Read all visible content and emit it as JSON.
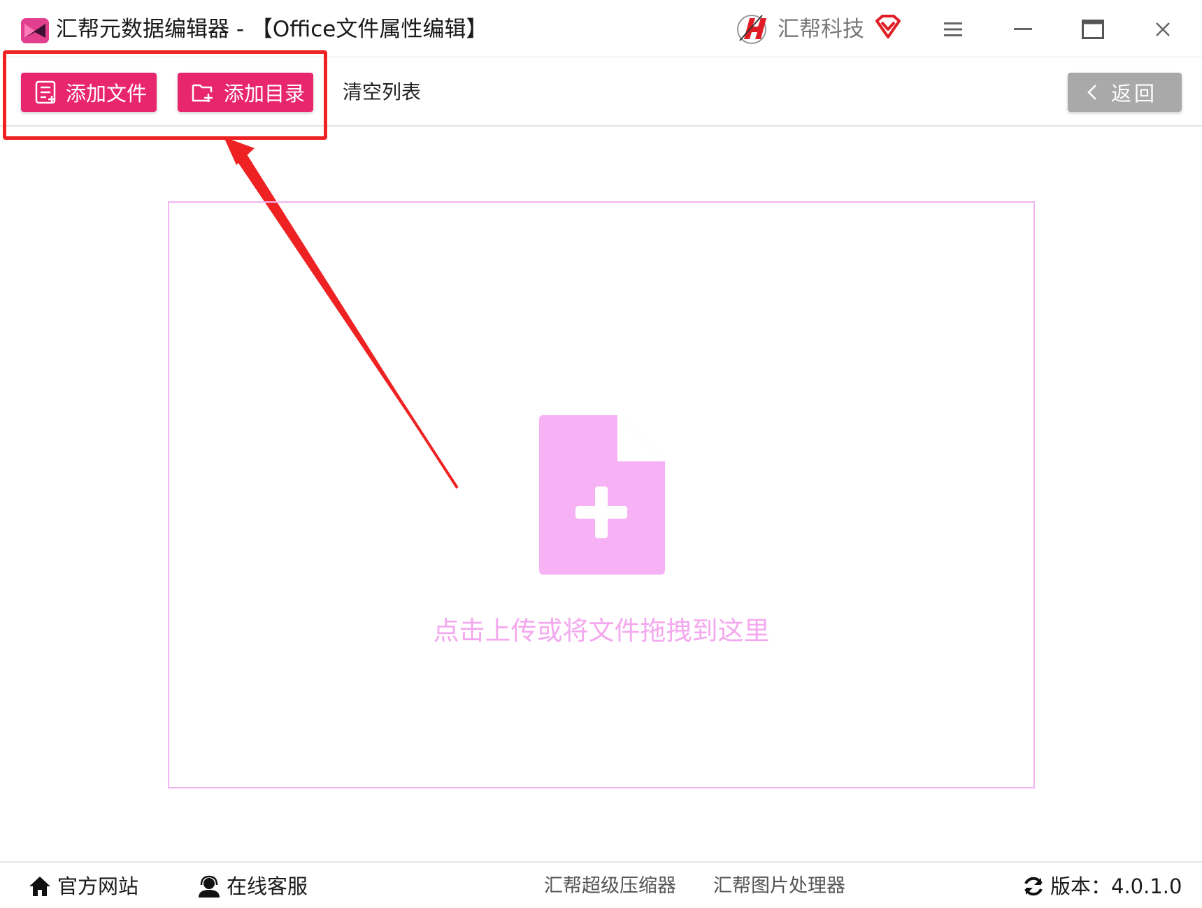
{
  "titlebar": {
    "title": "汇帮元数据编辑器 - 【Office文件属性编辑】",
    "brand": "汇帮科技"
  },
  "toolbar": {
    "add_file_label": "添加文件",
    "add_dir_label": "添加目录",
    "clear_label": "清空列表",
    "back_label": "返回"
  },
  "dropzone": {
    "hint": "点击上传或将文件拖拽到这里"
  },
  "footer": {
    "website": "官方网站",
    "service": "在线客服",
    "compressor": "汇帮超级压缩器",
    "image_tool": "汇帮图片处理器",
    "version": "版本：4.0.1.0"
  },
  "colors": {
    "accent": "#e8266e",
    "dropzone_border": "#f2b4f2",
    "dropzone_icon": "#f7b2f5",
    "annotation": "#ee2222",
    "back_button": "#a9a9a9"
  },
  "icons": {
    "app": "app-logo-icon",
    "brand": "brand-logo-icon",
    "vip": "vip-diamond-icon",
    "menu": "hamburger-menu-icon",
    "minimize": "minimize-icon",
    "maximize": "maximize-icon",
    "close": "close-icon",
    "add_file": "file-list-icon",
    "add_dir": "folder-plus-icon",
    "back": "chevron-left-icon",
    "drop": "file-plus-icon",
    "home": "home-icon",
    "service": "headset-icon",
    "refresh": "refresh-icon"
  }
}
